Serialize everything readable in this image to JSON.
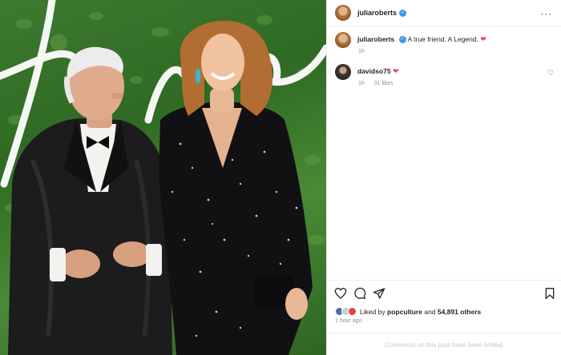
{
  "post": {
    "author": "juliaroberts",
    "more_icon": "more-horizontal-icon"
  },
  "caption": {
    "author": "juliaroberts",
    "text": "A true friend. A Legend.",
    "emoji": "❤",
    "time": "1h"
  },
  "comments": [
    {
      "author": "davidso75",
      "emoji": "❤",
      "time": "1h",
      "likes": "31 likes"
    }
  ],
  "actions": {
    "icons": [
      "heart-icon",
      "comment-icon",
      "share-icon",
      "bookmark-icon"
    ],
    "liked_by_prefix": "Liked by",
    "liked_by_user": "popculture",
    "liked_by_and": "and",
    "liked_by_count": "54,891 others",
    "time_ago": "1 hour ago"
  },
  "footer": {
    "limited_text": "Comments on this post have been limited."
  },
  "colors": {
    "verified": "#3897f0",
    "heart": "#ed4956",
    "foliage": "#3d7a2e"
  }
}
